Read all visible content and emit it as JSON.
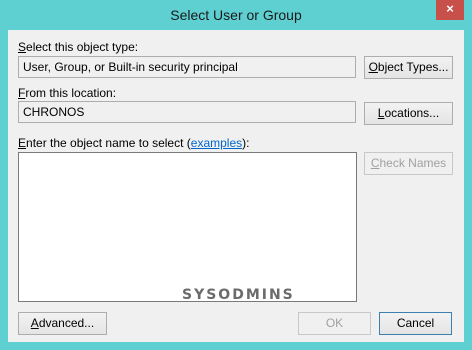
{
  "window": {
    "title": "Select User or Group",
    "close_glyph": "×"
  },
  "object_type": {
    "label_accel": "S",
    "label_rest": "elect this object type:",
    "value": "User, Group, or Built-in security principal",
    "button_accel": "O",
    "button_rest": "bject Types..."
  },
  "location": {
    "label_accel": "F",
    "label_rest": "rom this location:",
    "value": "CHRONOS",
    "button_accel": "L",
    "button_rest": "ocations..."
  },
  "object_name": {
    "label_accel": "E",
    "label_rest": "nter the object name to select (",
    "link": "examples",
    "label_end": "):",
    "value": "",
    "check_accel": "C",
    "check_rest": "heck Names"
  },
  "footer": {
    "advanced_accel": "A",
    "advanced_rest": "dvanced...",
    "ok_label": "OK",
    "cancel_label": "Cancel",
    "watermark": "SYSODMINS"
  }
}
